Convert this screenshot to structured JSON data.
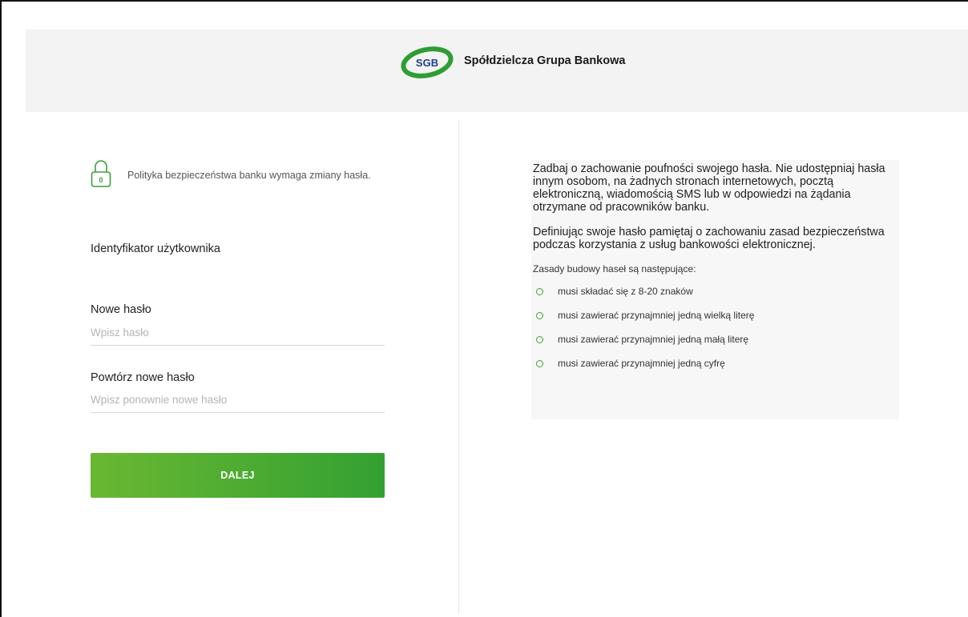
{
  "brand": {
    "logo_mark": "SGB",
    "name": "Spółdzielcza Grupa Bankowa",
    "accent_color": "#2e9d35"
  },
  "notice": {
    "icon": "lock-icon",
    "text": "Polityka bezpieczeństwa banku wymaga zmiany hasła."
  },
  "form": {
    "user_id_label": "Identyfikator użytkownika",
    "new_password": {
      "label": "Nowe hasło",
      "placeholder": "Wpisz hasło",
      "value": ""
    },
    "repeat_password": {
      "label": "Powtórz nowe hasło",
      "placeholder": "Wpisz ponownie nowe hasło",
      "value": ""
    },
    "submit_label": "DALEJ"
  },
  "info": {
    "paragraph1": "Zadbaj o zachowanie poufności swojego hasła. Nie udostępniaj hasła innym osobom, na żadnych stronach internetowych, pocztą elektroniczną, wiadomością SMS lub w odpowiedzi na żądania otrzymane od pracowników banku.",
    "paragraph2": "Definiując swoje hasło pamiętaj o zachowaniu zasad bezpieczeństwa podczas korzystania z usług bankowości elektronicznej.",
    "rules_title": "Zasady budowy haseł są następujące:",
    "rules": [
      "musi składać się z 8-20 znaków",
      "musi zawierać przynajmniej jedną wielką literę",
      "musi zawierać przynajmniej jedną małą literę",
      "musi zawierać przynajmniej jedną cyfrę"
    ]
  }
}
